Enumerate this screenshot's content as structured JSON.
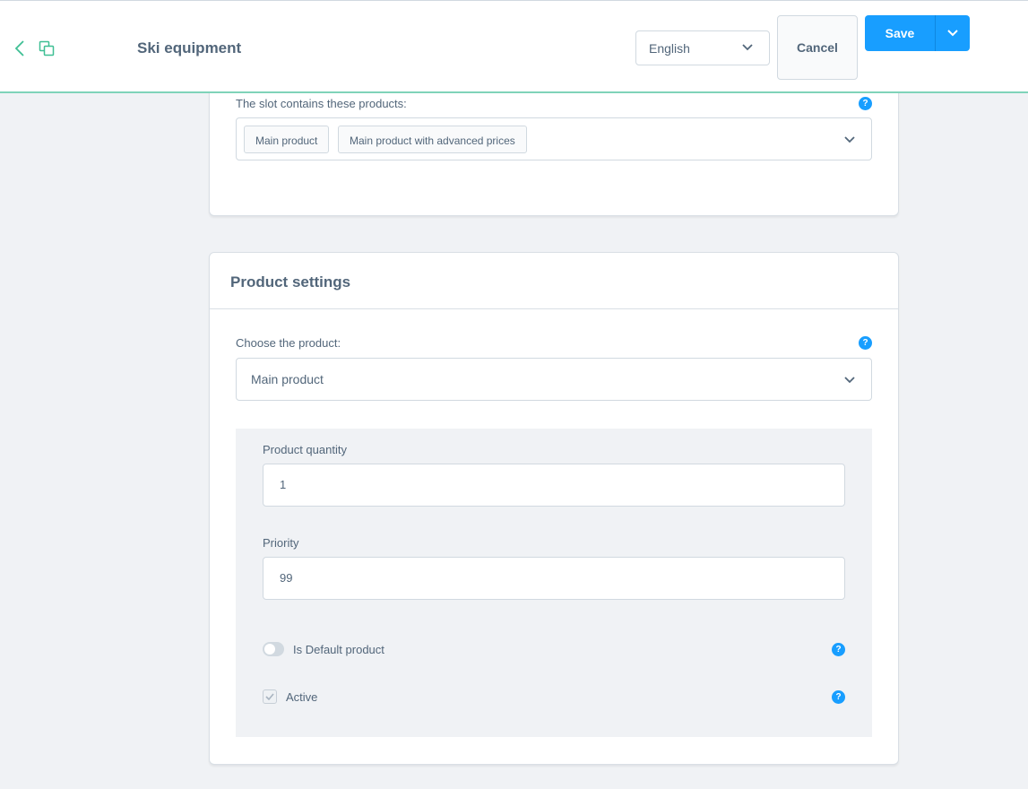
{
  "header": {
    "title": "Ski equipment",
    "language": "English",
    "cancel_label": "Cancel",
    "save_label": "Save",
    "accent_color": "#189eff",
    "icons": [
      "back-icon",
      "copy-icon",
      "chevron-down-icon"
    ]
  },
  "slot_card": {
    "products_label": "The slot contains these products:",
    "help_label": "?",
    "selected_products": [
      "Main product",
      "Main product with advanced prices"
    ]
  },
  "settings_card": {
    "title": "Product settings",
    "choose_label": "Choose the product:",
    "chosen_product": "Main product",
    "quantity_label": "Product quantity",
    "quantity_value": "1",
    "priority_label": "Priority",
    "priority_value": "99",
    "default_label": "Is Default product",
    "default_on": false,
    "active_label": "Active",
    "active_checked": true,
    "help_label": "?"
  }
}
